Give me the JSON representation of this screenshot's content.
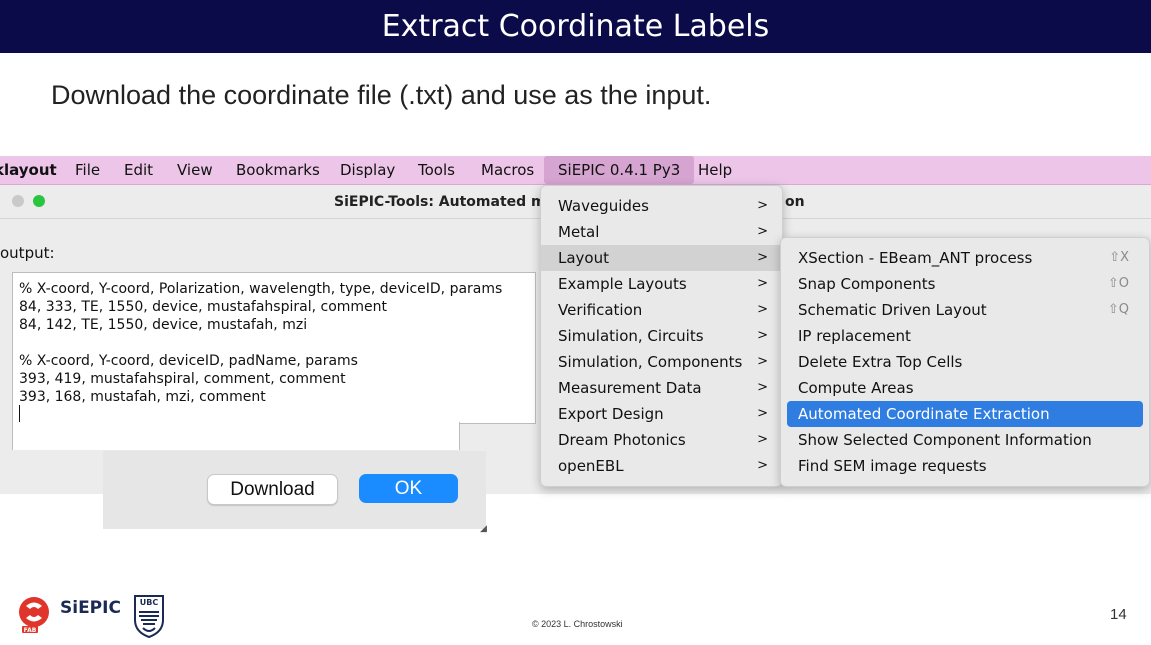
{
  "slide": {
    "title": "Extract Coordinate Labels",
    "subtitle": "Download the coordinate file (.txt) and use as the input.",
    "copyright": "© 2023 L. Chrostowski",
    "page_number": "14",
    "logo_text": "SiEPIC",
    "logo_sub": "FAB",
    "ubc_text": "UBC"
  },
  "menubar": {
    "items": [
      "klayout",
      "File",
      "Edit",
      "View",
      "Bookmarks",
      "Display",
      "Tools",
      "Macros",
      "SiEPIC 0.4.1 Py3",
      "Help"
    ]
  },
  "window": {
    "title": "SiEPIC-Tools: Automated m",
    "title_tail": "on",
    "output_label": "output:",
    "text_lines": [
      "% X-coord, Y-coord, Polarization, wavelength, type, deviceID, params",
      "84, 333, TE, 1550, device, mustafahspiral, comment",
      "84, 142, TE, 1550, device, mustafah, mzi",
      "",
      "% X-coord, Y-coord, deviceID, padName, params",
      "393, 419, mustafahspiral, comment, comment",
      "393, 168, mustafah, mzi, comment"
    ]
  },
  "dialog": {
    "download_label": "Download",
    "ok_label": "OK"
  },
  "siepic_menu": {
    "items": [
      "Waveguides",
      "Metal",
      "Layout",
      "Example Layouts",
      "Verification",
      "Simulation, Circuits",
      "Simulation, Components",
      "Measurement Data",
      "Export Design",
      "Dream Photonics",
      "openEBL"
    ],
    "arrow": ">"
  },
  "layout_menu": {
    "items": [
      "XSection - EBeam_ANT process",
      "Snap Components",
      "Schematic Driven Layout",
      "IP replacement",
      "Delete Extra Top Cells",
      "Compute Areas",
      "Automated Coordinate Extraction",
      "Show Selected Component Information",
      "Find SEM image requests"
    ],
    "shortcuts": [
      "⇧X",
      "⇧O",
      "⇧Q"
    ]
  },
  "colors": {
    "title_bar": "#0b0b4a",
    "menubar": "#ecc5e8",
    "highlight": "#2f7de1",
    "ok_button": "#1a8cff"
  }
}
